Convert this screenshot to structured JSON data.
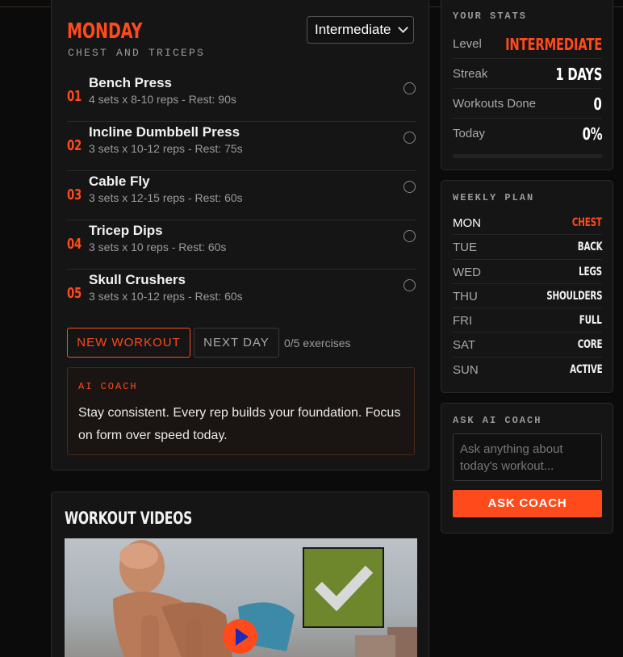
{
  "accent_color": "#ff4a1c",
  "workout": {
    "day": "MONDAY",
    "focus": "CHEST AND TRICEPS",
    "level_selected": "Intermediate",
    "exercises": [
      {
        "num": "01",
        "name": "Bench Press",
        "detail": "4 sets x 8-10 reps - Rest: 90s",
        "done": false
      },
      {
        "num": "02",
        "name": "Incline Dumbbell Press",
        "detail": "3 sets x 10-12 reps - Rest: 75s",
        "done": false
      },
      {
        "num": "03",
        "name": "Cable Fly",
        "detail": "3 sets x 12-15 reps - Rest: 60s",
        "done": false
      },
      {
        "num": "04",
        "name": "Tricep Dips",
        "detail": "3 sets x 10 reps - Rest: 60s",
        "done": false
      },
      {
        "num": "05",
        "name": "Skull Crushers",
        "detail": "3 sets x 10-12 reps - Rest: 60s",
        "done": false
      }
    ],
    "new_workout_label": "NEW WORKOUT",
    "next_day_label": "NEXT DAY",
    "progress_text": "0/5 exercises",
    "coach_label": "AI COACH",
    "coach_message": "Stay consistent. Every rep builds your foundation. Focus on form over speed today."
  },
  "videos": {
    "title": "WORKOUT VIDEOS",
    "thumbnail_icons": [
      "checkmark-icon",
      "play-icon"
    ]
  },
  "stats": {
    "label": "YOUR STATS",
    "rows": [
      {
        "key": "Level",
        "value": "INTERMEDIATE",
        "accent": true
      },
      {
        "key": "Streak",
        "value": "1 DAYS",
        "accent": false
      },
      {
        "key": "Workouts Done",
        "value": "0",
        "accent": false
      },
      {
        "key": "Today",
        "value": "0%",
        "accent": false
      }
    ],
    "today_progress": 0
  },
  "plan": {
    "label": "WEEKLY PLAN",
    "days": [
      {
        "day": "MON",
        "focus": "CHEST",
        "active": true
      },
      {
        "day": "TUE",
        "focus": "BACK",
        "active": false
      },
      {
        "day": "WED",
        "focus": "LEGS",
        "active": false
      },
      {
        "day": "THU",
        "focus": "SHOULDERS",
        "active": false
      },
      {
        "day": "FRI",
        "focus": "FULL",
        "active": false
      },
      {
        "day": "SAT",
        "focus": "CORE",
        "active": false
      },
      {
        "day": "SUN",
        "focus": "ACTIVE",
        "active": false
      }
    ]
  },
  "ask": {
    "label": "ASK AI COACH",
    "placeholder": "Ask anything about today's workout...",
    "button_label": "ASK COACH"
  }
}
